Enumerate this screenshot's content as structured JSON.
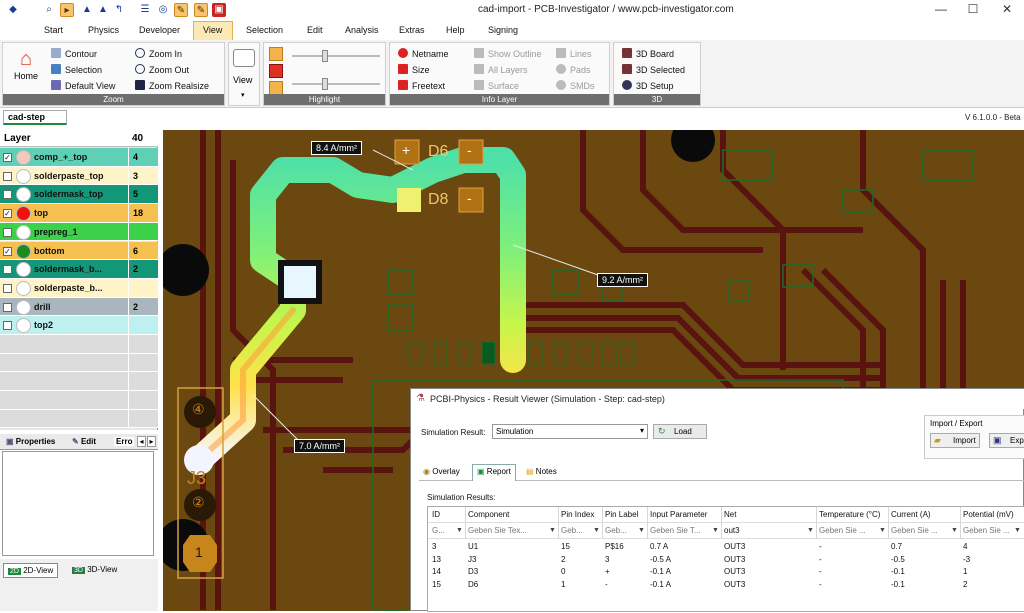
{
  "window": {
    "title": "cad-import - PCB-Investigator / www.pcb-investigator.com",
    "minimize": "—",
    "maximize": "☐",
    "close": "✕"
  },
  "menu": {
    "items": [
      "Start",
      "Physics",
      "Developer",
      "View",
      "Selection",
      "Edit",
      "Analysis",
      "Extras",
      "Help",
      "Signing"
    ],
    "active": "View"
  },
  "ribbon": {
    "zoom": {
      "label": "Zoom",
      "home": "Home",
      "contour": "Contour",
      "selection": "Selection",
      "default_view": "Default View",
      "zoom_in": "Zoom In",
      "zoom_out": "Zoom Out",
      "zoom_realsize": "Zoom Realsize"
    },
    "view": {
      "label": "View"
    },
    "highlight": {
      "label": "Highlight"
    },
    "info_layer": {
      "label": "Info Layer",
      "netname": "Netname",
      "size": "Size",
      "freetext": "Freetext",
      "show_outline": "Show Outline",
      "all_layers": "All Layers",
      "surface": "Surface",
      "lines": "Lines",
      "pads": "Pads",
      "smds": "SMDs"
    },
    "three_d": {
      "label": "3D",
      "board": "3D Board",
      "selected": "3D Selected",
      "setup": "3D Setup"
    }
  },
  "doc_tab": "cad-step",
  "version": "V 6.1.0.0 - Beta",
  "layers": {
    "header": "Layer",
    "count": "40",
    "rows": [
      {
        "name": "comp_+_top",
        "count": "4",
        "checked": "✓",
        "swatch": "#f2c9bf",
        "bg": "#5fd0b5"
      },
      {
        "name": "solderpaste_top",
        "count": "3",
        "checked": "",
        "swatch": "#ffffff",
        "bg": "#fff4c8"
      },
      {
        "name": "soldermask_top",
        "count": "5",
        "checked": "",
        "swatch": "#ffffff",
        "bg": "#149678"
      },
      {
        "name": "top",
        "count": "18",
        "checked": "✓",
        "swatch": "#ee1111",
        "bg": "#f5c050"
      },
      {
        "name": "prepreg_1",
        "count": "",
        "checked": "",
        "swatch": "#ffffff",
        "bg": "#3bd24a"
      },
      {
        "name": "bottom",
        "count": "6",
        "checked": "✓",
        "swatch": "#1f8a1f",
        "bg": "#f5c050"
      },
      {
        "name": "soldermask_b...",
        "count": "2",
        "checked": "",
        "swatch": "#ffffff",
        "bg": "#149678"
      },
      {
        "name": "solderpaste_b...",
        "count": "",
        "checked": "",
        "swatch": "#ffffff",
        "bg": "#fff4c8"
      },
      {
        "name": "drill",
        "count": "2",
        "checked": "",
        "swatch": "#ffffff",
        "bg": "#a9b6be"
      },
      {
        "name": "top2",
        "count": "",
        "checked": "",
        "swatch": "#ffffff",
        "bg": "#bff0f0"
      }
    ]
  },
  "panel_tabs": [
    "Properties",
    "Edit",
    "Erro"
  ],
  "view_tabs": [
    "2D-View",
    "3D-View"
  ],
  "board": {
    "label_84": "8.4 A/mm²",
    "label_92": "9.2 A/mm²",
    "label_70": "7.0 A/mm²",
    "d6": "D6",
    "d8": "D8",
    "plus": "+",
    "minus": "-",
    "j3": "J3",
    "pin4": "④",
    "pin2": "②",
    "pin1": "1"
  },
  "sim": {
    "title": "PCBI-Physics - Result Viewer (Simulation - Step: cad-step)",
    "result_label": "Simulation Result:",
    "result_value": "Simulation",
    "load": "Load",
    "import_export": "Import / Export",
    "import": "Import",
    "export": "Exp",
    "tabs": [
      "Overlay",
      "Report",
      "Notes"
    ],
    "results_label": "Simulation Results:",
    "columns": [
      "ID",
      "Component",
      "Pin Index",
      "Pin Label",
      "Input Parameter",
      "Net",
      "Temperature (°C)",
      "Current (A)",
      "Potential (mV)"
    ],
    "filters": [
      "G...",
      "Geben Sie Tex...",
      "Geb...",
      "Geb...",
      "Geben Sie T...",
      "out3",
      "Geben Sie ...",
      "Geben Sie ...",
      "Geben Sie ..."
    ],
    "rows": [
      [
        "3",
        "U1",
        "15",
        "P$16",
        "0.7 A",
        "OUT3",
        "-",
        "0.7",
        "4"
      ],
      [
        "13",
        "J3",
        "2",
        "3",
        "-0.5 A",
        "OUT3",
        "-",
        "-0.5",
        "-3"
      ],
      [
        "14",
        "D3",
        "0",
        "+",
        "-0.1 A",
        "OUT3",
        "-",
        "-0.1",
        "1"
      ],
      [
        "15",
        "D6",
        "1",
        "-",
        "-0.1 A",
        "OUT3",
        "-",
        "-0.1",
        "2"
      ]
    ]
  }
}
